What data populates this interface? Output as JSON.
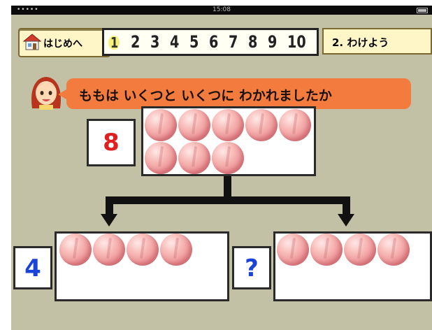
{
  "status_bar": {
    "time": "15:08"
  },
  "toolbar": {
    "home_label": "はじめへ",
    "levels": [
      "1",
      "2",
      "3",
      "4",
      "5",
      "6",
      "7",
      "8",
      "9",
      "10"
    ],
    "current_level": "1",
    "next_label": "2. わけよう"
  },
  "question": {
    "text": "ももは いくつと いくつに わかれましたか"
  },
  "total": {
    "number": "8",
    "peach_count": 8,
    "color": "#e02020"
  },
  "left_part": {
    "number": "4",
    "peach_count": 4,
    "color": "#1a44d8"
  },
  "right_part": {
    "number": "?",
    "peach_count": 4,
    "color": "#1a44d8"
  },
  "colors": {
    "background": "#c2c0a5",
    "bubble": "#f27b3d",
    "button": "#fff6c8"
  }
}
